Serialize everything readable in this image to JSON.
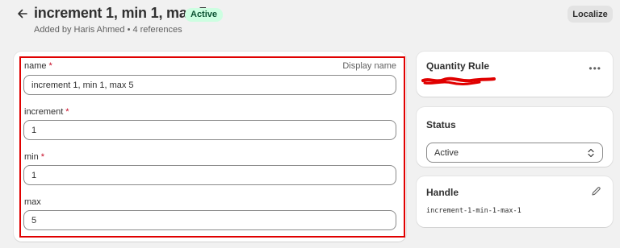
{
  "header": {
    "title": "increment 1, min 1, max 5",
    "status_badge": "Active",
    "subtitle": "Added by Haris Ahmed • 4 references",
    "localize_label": "Localize",
    "back_icon": "arrow-left-icon"
  },
  "form": {
    "display_name_hint": "Display name",
    "fields": [
      {
        "label": "name",
        "required": true,
        "value": "increment 1, min 1, max 5"
      },
      {
        "label": "increment",
        "required": true,
        "value": "1"
      },
      {
        "label": "min",
        "required": true,
        "value": "1"
      },
      {
        "label": "max",
        "required": false,
        "value": "5"
      }
    ],
    "required_marker": "*"
  },
  "sidebar": {
    "definition": {
      "title": "Quantity Rule",
      "menu_icon": "more-horizontal-icon"
    },
    "status": {
      "title": "Status",
      "selected": "Active",
      "icon": "select-chevron-icon"
    },
    "handle": {
      "title": "Handle",
      "value": "increment-1-min-1-max-1",
      "icon": "pencil-icon"
    }
  },
  "colors": {
    "background": "#f1f1f1",
    "badge_bg": "#cdfee1",
    "badge_text": "#0c5132",
    "required": "#c70a24",
    "annotation_red": "#e00000"
  }
}
